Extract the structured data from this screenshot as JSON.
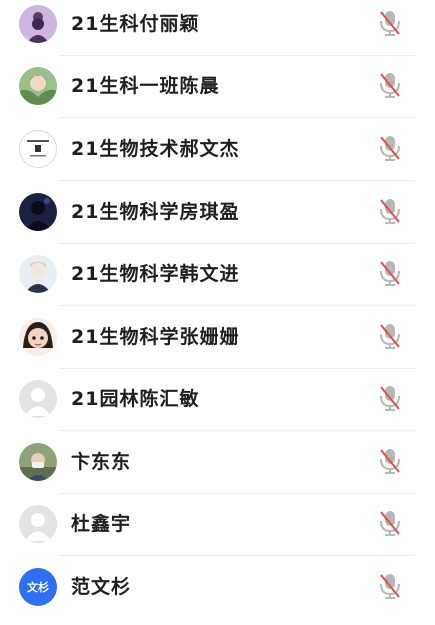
{
  "members": [
    {
      "name": "21生科付丽颖",
      "avatar": "lady-with-bun-avatar",
      "mic": "muted"
    },
    {
      "name": "21生科一班陈晨",
      "avatar": "girl-photo-avatar",
      "mic": "muted"
    },
    {
      "name": "21生物技术郝文杰",
      "avatar": "text-logo-avatar",
      "mic": "muted"
    },
    {
      "name": "21生物科学房琪盈",
      "avatar": "dark-silhouette-avatar",
      "mic": "muted"
    },
    {
      "name": "21生物科学韩文进",
      "avatar": "anime-character-avatar",
      "mic": "muted"
    },
    {
      "name": "21生物科学张姗姗",
      "avatar": "cartoon-girl-avatar",
      "mic": "muted"
    },
    {
      "name": "21园林陈汇敏",
      "avatar": "default-gray-avatar",
      "mic": "muted"
    },
    {
      "name": "卞东东",
      "avatar": "photo-avatar",
      "mic": "muted"
    },
    {
      "name": "杜鑫宇",
      "avatar": "default-gray-avatar",
      "mic": "muted"
    },
    {
      "name": "范文杉",
      "avatar": "blue-initials-avatar",
      "avatar_text": "文杉",
      "mic": "muted"
    }
  ],
  "colors": {
    "mic_gray": "#b8b8b8",
    "mic_slash_red": "#e05050",
    "name_text": "#1f1f1f",
    "initials_bg": "#2f6ff0"
  }
}
